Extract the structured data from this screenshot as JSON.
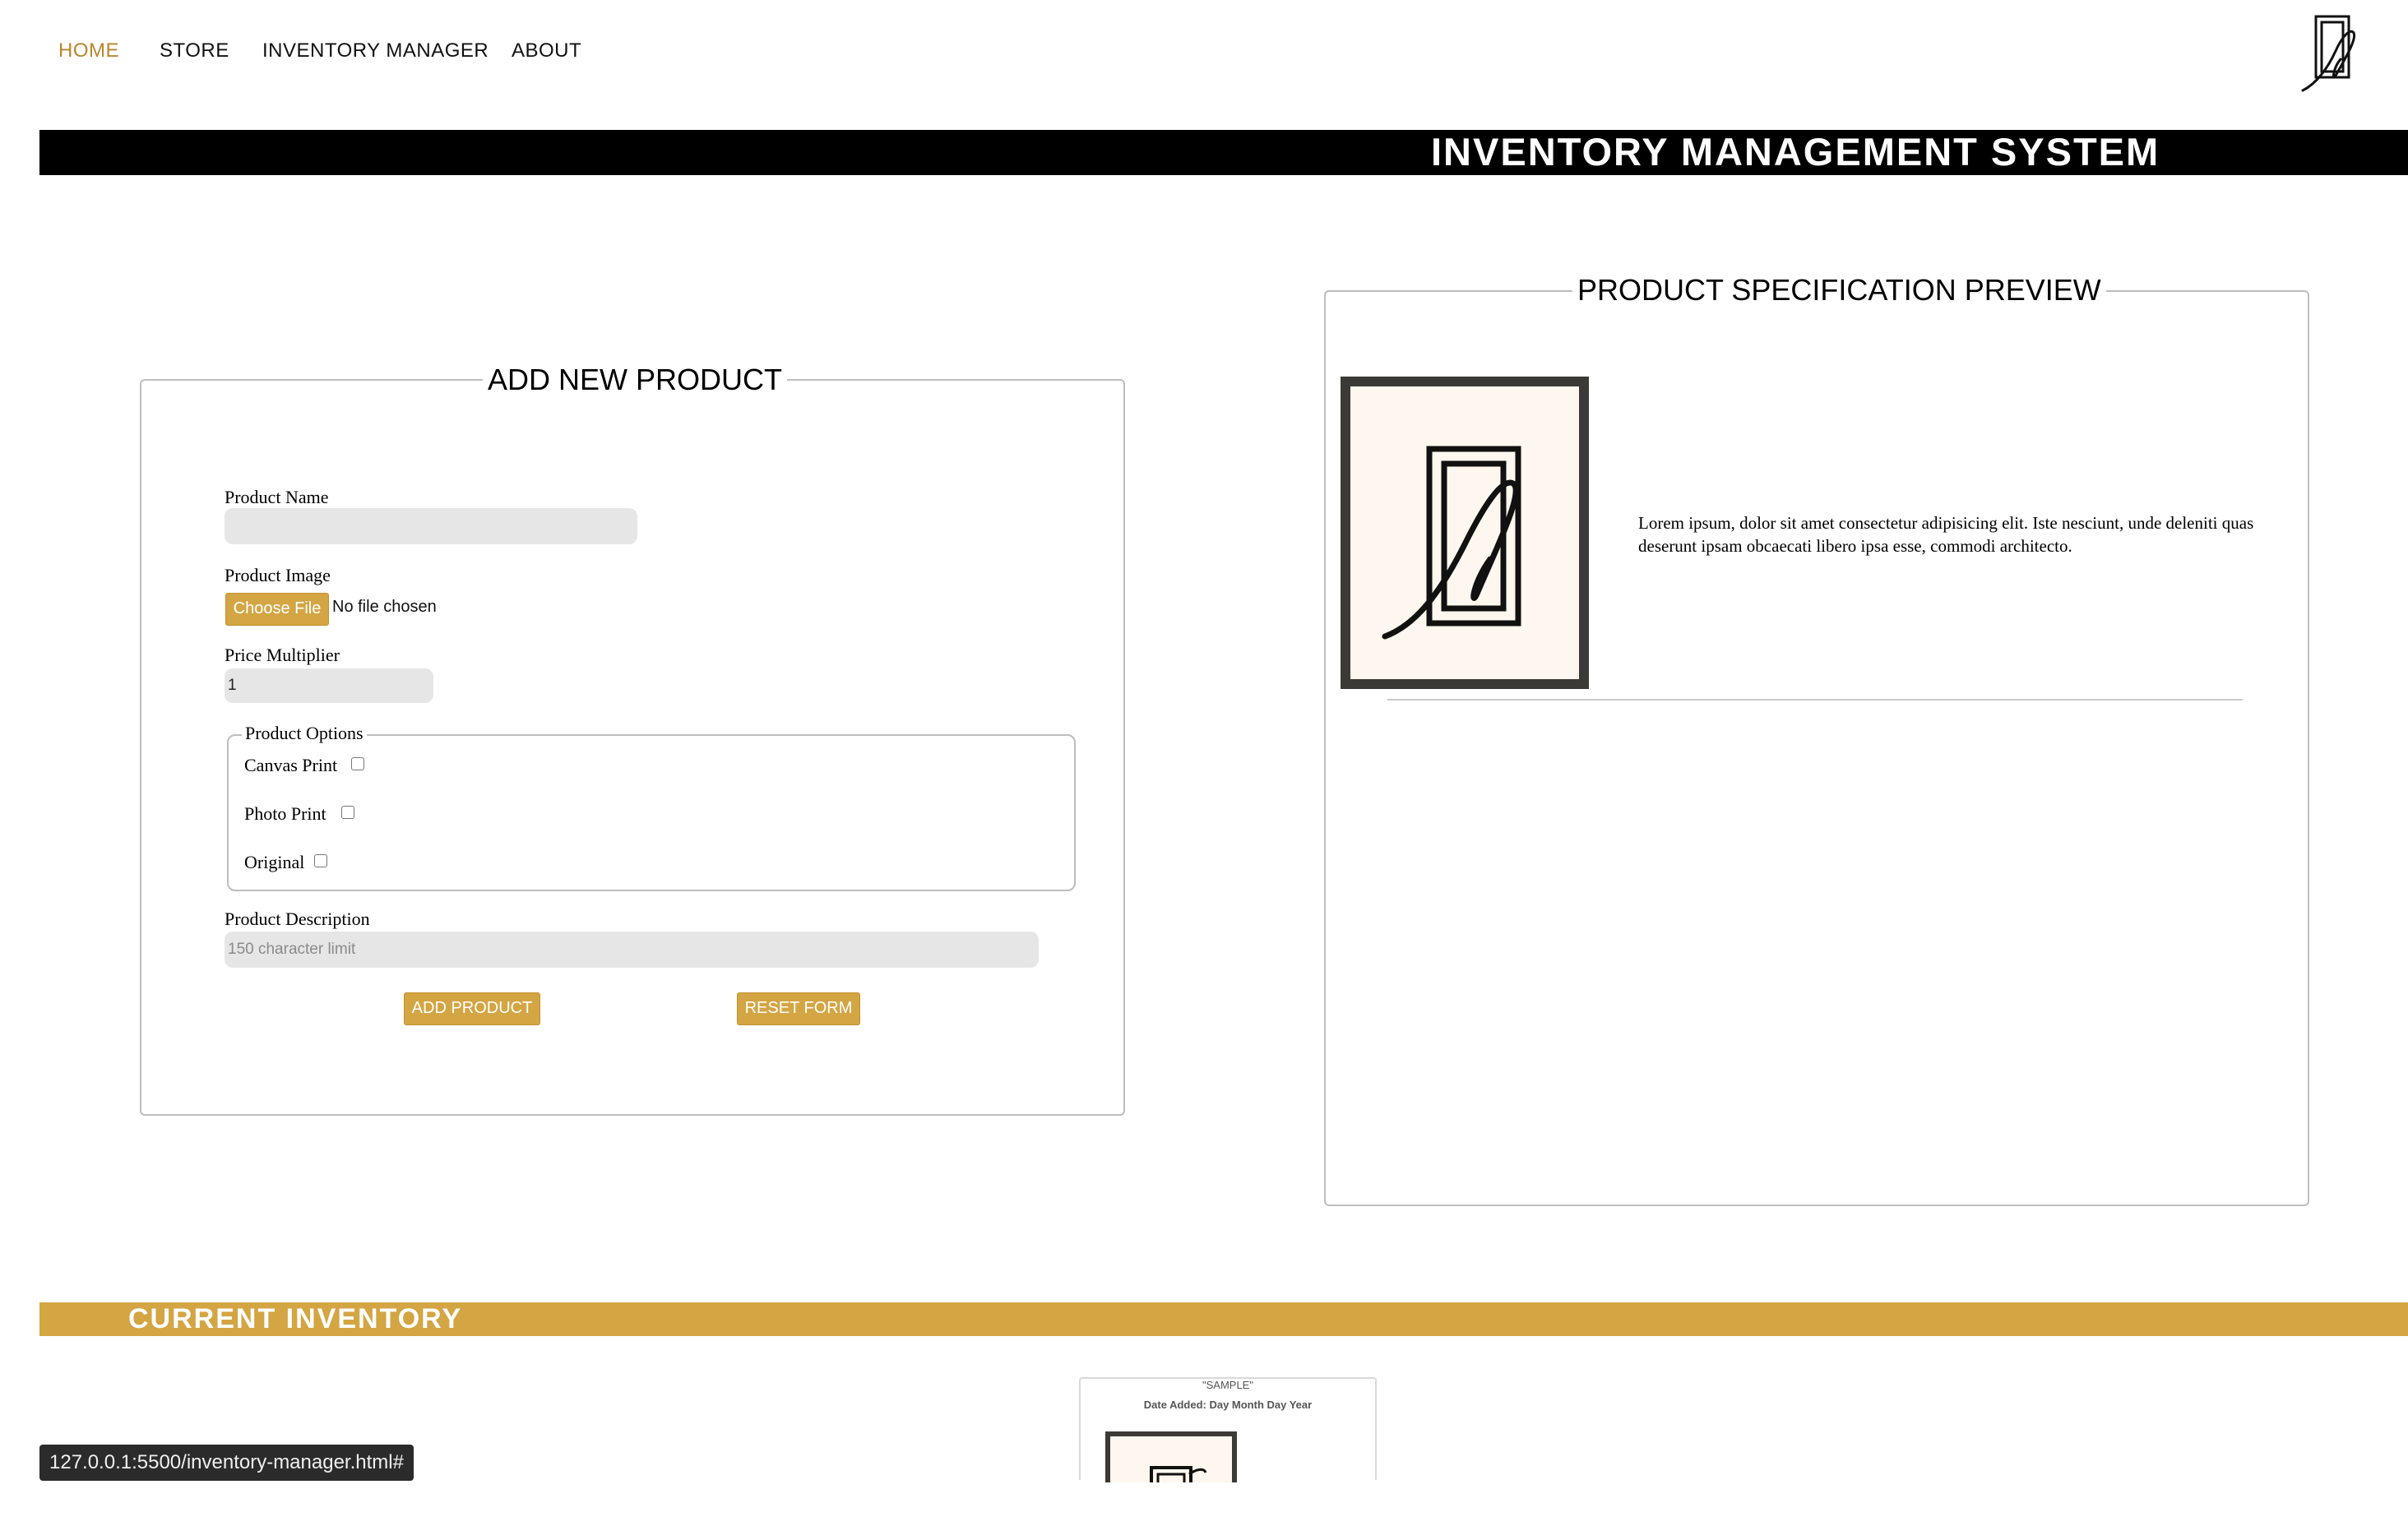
{
  "nav": {
    "items": [
      {
        "label": "HOME",
        "active": true
      },
      {
        "label": "STORE",
        "active": false
      },
      {
        "label": "INVENTORY MANAGER",
        "active": false
      },
      {
        "label": "ABOUT",
        "active": false
      }
    ],
    "logo_icon": "signature-frame-logo-icon"
  },
  "header": {
    "title": "INVENTORY MANAGEMENT SYSTEM"
  },
  "form": {
    "legend": "ADD NEW PRODUCT",
    "product_name_label": "Product Name",
    "product_name_value": "",
    "product_image_label": "Product Image",
    "choose_file_label": "Choose File",
    "no_file_text": "No file chosen",
    "price_multiplier_label": "Price Multiplier",
    "price_multiplier_value": "1",
    "options_legend": "Product Options",
    "options": [
      {
        "label": "Canvas Print",
        "checked": false
      },
      {
        "label": "Photo Print",
        "checked": false
      },
      {
        "label": "Original",
        "checked": false
      }
    ],
    "description_label": "Product Description",
    "description_placeholder": "150 character limit",
    "add_button": "ADD PRODUCT",
    "reset_button": "RESET FORM"
  },
  "preview": {
    "legend": "PRODUCT SPECIFICATION PREVIEW",
    "description": "Lorem ipsum, dolor sit amet consectetur adipisicing elit. Iste nesciunt, unde deleniti quas deserunt ipsam obcaecati libero ipsa esse, commodi architecto."
  },
  "inventory": {
    "title": "CURRENT INVENTORY",
    "card": {
      "sample_label": "\"SAMPLE\"",
      "date_added": "Date Added: Day Month Day Year"
    }
  },
  "status_bar": {
    "url": "127.0.0.1:5500/inventory-manager.html#"
  },
  "colors": {
    "accent_gold": "#d3a543",
    "nav_active": "#b8862b",
    "header_bg": "#000000",
    "frame": "#3c3a36",
    "canvas_bg": "#fdf7ef"
  }
}
